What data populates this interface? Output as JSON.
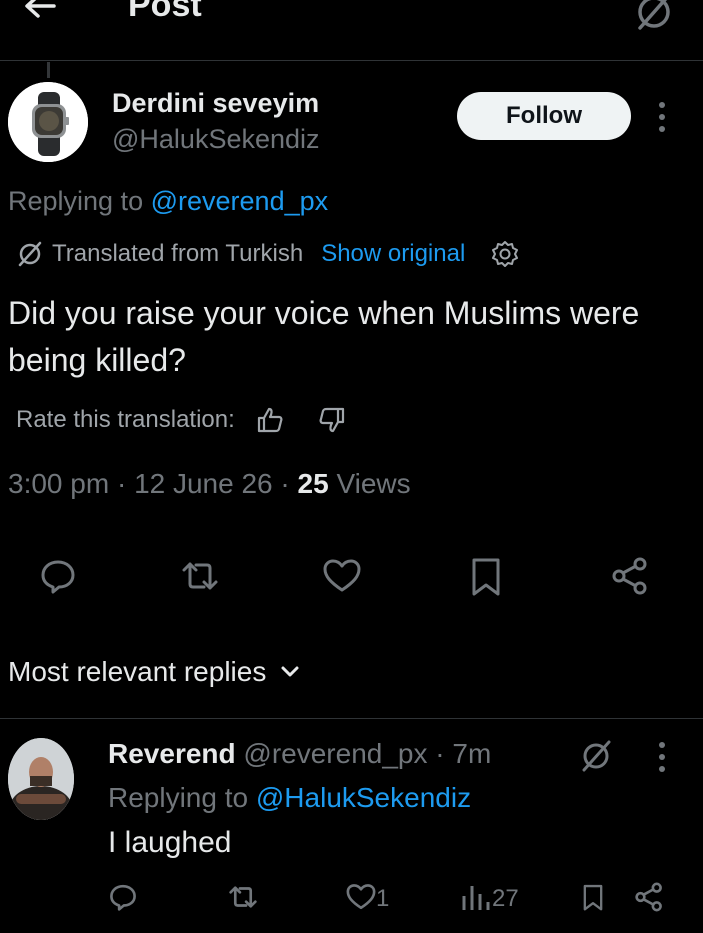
{
  "header": {
    "title": "Post"
  },
  "post": {
    "author_name": "Derdini seveyim",
    "author_handle": "@HalukSekendiz",
    "follow_label": "Follow",
    "replying_prefix": "Replying to",
    "replying_handle": "@reverend_px",
    "translated_label": "Translated from Turkish",
    "show_original": "Show original",
    "text": "Did you raise your voice when Muslims were being killed?",
    "rate_label": "Rate this translation:",
    "time": "3:00 pm",
    "date": "12 June 26",
    "views_count": "25",
    "views_label": "Views"
  },
  "replies_filter": "Most relevant replies",
  "reply": {
    "author_name": "Reverend",
    "author_handle": "@reverend_px",
    "age": "7m",
    "replying_prefix": "Replying to",
    "replying_handle": "@HalukSekendiz",
    "text": "I laughed",
    "likes": "1",
    "views": "27"
  },
  "colors": {
    "background": "#000000",
    "text": "#e7e9ea",
    "muted": "#71767b",
    "link": "#1d9bf0"
  }
}
